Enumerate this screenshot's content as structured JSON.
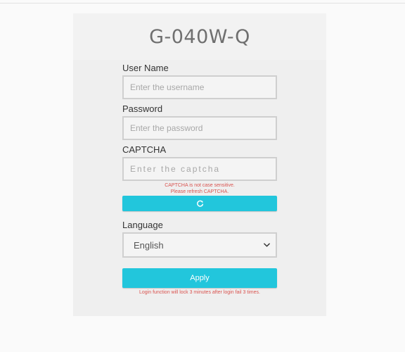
{
  "header": {
    "device_name": "G-040W-Q"
  },
  "login_form": {
    "username": {
      "label": "User Name",
      "placeholder": "Enter the username",
      "value": ""
    },
    "password": {
      "label": "Password",
      "placeholder": "Enter the password",
      "value": ""
    },
    "captcha": {
      "label": "CAPTCHA",
      "placeholder": "Enter the captcha",
      "value": "",
      "note_line1": "CAPTCHA is not case sensitive.",
      "note_line2": "Please refresh CAPTCHA.",
      "refresh_icon": "refresh-icon"
    },
    "language": {
      "label": "Language",
      "selected": "English",
      "arrow_icon": "chevron-down-icon"
    },
    "apply_label": "Apply",
    "lock_note": "Login function will lock 3 minutes after login fail 3 times."
  },
  "colors": {
    "accent": "#22c6dc",
    "warning_text": "#d9534f",
    "card_background": "#efefef"
  }
}
